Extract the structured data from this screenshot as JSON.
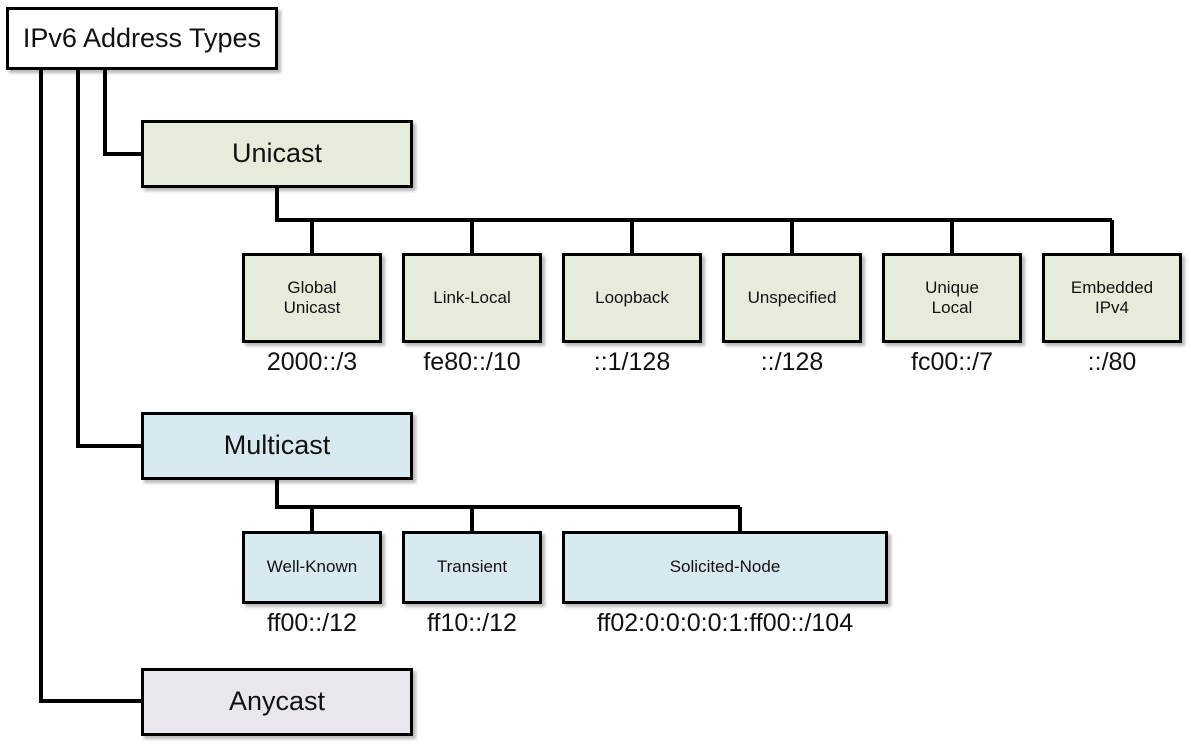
{
  "diagram": {
    "title": "IPv6 Address Types",
    "root": {
      "label": "IPv6 Address Types",
      "fill": "#ffffff"
    },
    "branches": [
      {
        "key": "unicast",
        "label": "Unicast",
        "fill": "#e6ecdc",
        "children": [
          {
            "label": "Global\nUnicast",
            "caption": "2000::/3"
          },
          {
            "label": "Link-Local",
            "caption": "fe80::/10"
          },
          {
            "label": "Loopback",
            "caption": "::1/128"
          },
          {
            "label": "Unspecified",
            "caption": "::/128"
          },
          {
            "label": "Unique\nLocal",
            "caption": "fc00::/7"
          },
          {
            "label": "Embedded\nIPv4",
            "caption": "::/80"
          }
        ]
      },
      {
        "key": "multicast",
        "label": "Multicast",
        "fill": "#d8e9ef",
        "children": [
          {
            "label": "Well-Known",
            "caption": "ff00::/12"
          },
          {
            "label": "Transient",
            "caption": "ff10::/12"
          },
          {
            "label": "Solicited-Node",
            "caption": "ff02:0:0:0:0:1:ff00::/104"
          }
        ]
      },
      {
        "key": "anycast",
        "label": "Anycast",
        "fill": "#eae6ee",
        "children": []
      }
    ],
    "colors": {
      "line": "#000000",
      "text": "#111111",
      "background": "#ffffff"
    }
  }
}
